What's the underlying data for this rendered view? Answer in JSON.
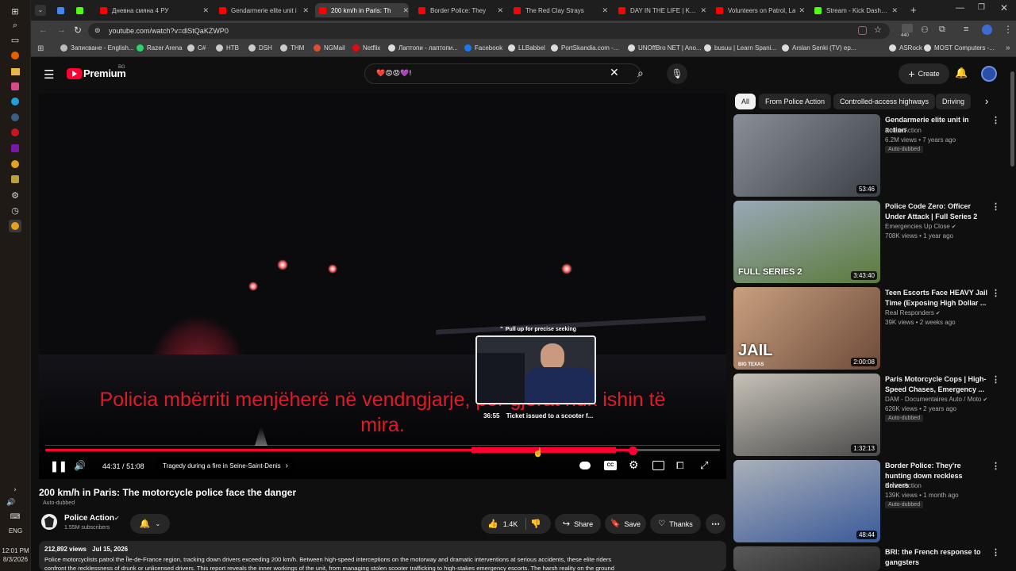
{
  "taskbar": {
    "time": "12:01 PM",
    "date": "8/3/2026",
    "lang": "ENG"
  },
  "tabs": [
    {
      "title": "",
      "active": false,
      "color": "#4285f4"
    },
    {
      "title": "",
      "active": false,
      "color": "#53fc18"
    },
    {
      "title": "Дневна смяна 4 РУ",
      "active": false,
      "color": "#ff0000"
    },
    {
      "title": "Gendarmerie elite unit i",
      "active": false,
      "color": "#ff0000"
    },
    {
      "title": "200 km/h in Paris: Th",
      "active": true,
      "color": "#ff0000"
    },
    {
      "title": "Border Police: They",
      "active": false,
      "color": "#ff0000"
    },
    {
      "title": "The Red Clay Strays",
      "active": false,
      "color": "#ff0000"
    },
    {
      "title": "DAY IN THE LIFE | K-9 D",
      "active": false,
      "color": "#ff0000"
    },
    {
      "title": "Volunteers on Patrol, La",
      "active": false,
      "color": "#ff0000"
    },
    {
      "title": "Stream - Kick Dashboard",
      "active": false,
      "color": "#53fc18"
    }
  ],
  "address": {
    "url": "youtube.com/watch?v=dlStQaKZWP0",
    "extension_count": "440"
  },
  "bookmarks": [
    "Записване - English...",
    "Razer Arena",
    "C#",
    "HTB",
    "DSH",
    "THM",
    "NGMail",
    "Netflix",
    "Лаптопи - лаптопи...",
    "Facebook",
    "LLBabbel",
    "PortSkandia.com -...",
    "UNOffBro NET | Ano...",
    "busuu | Learn Spani...",
    "Arslan Senki (TV) ep...",
    "ASRock",
    "MOST Computers -..."
  ],
  "header": {
    "logo_text": "Premium",
    "logo_badge": "BG",
    "search_value": "❤️😡😡💜!",
    "create_label": "Create"
  },
  "chips": [
    "All",
    "From Police Action",
    "Controlled-access highways",
    "Driving"
  ],
  "player": {
    "caption_line1": "Policia mbërriti menjëherë në vendngjarje, por gjërat nuk ishin të",
    "caption_line2": "mira.",
    "pull_hint": "⌃ Pull up for precise seeking",
    "preview_time": "36:55",
    "preview_chapter": "Ticket issued to a scooter f...",
    "time_current": "44:31",
    "time_total": "51:08",
    "time_sep": "/",
    "chapter": "Tragedy during a fire in Seine-Saint-Denis",
    "progress_fraction": 0.87
  },
  "video": {
    "title": "200 km/h in Paris: The motorcycle police face the danger",
    "auto_dubbed": "Auto-dubbed",
    "channel": "Police Action",
    "subscribers": "1.55M subscribers",
    "likes": "1.4K",
    "share_label": "Share",
    "save_label": "Save",
    "thanks_label": "Thanks",
    "views": "212,892 views",
    "date": "Jul 15, 2026",
    "description_line1": "Police motorcyclists patrol the Île-de-France region, tracking down drivers exceeding 200 km/h. Between high-speed interceptions on the motorway and dramatic interventions at serious accidents, these elite riders",
    "description_line2": "confront the recklessness of drunk or unlicensed drivers. This report reveals the inner workings of the unit, from managing stolen scooter trafficking to high-stakes emergency escorts. The harsh reality on the ground"
  },
  "recommendations": [
    {
      "title": "Gendarmerie elite unit in action",
      "channel": "Police Action",
      "verified": false,
      "meta": "6.2M views • 7 years ago",
      "badge": "Auto-dubbed",
      "duration": "53:46"
    },
    {
      "title": "Police Code Zero: Officer Under Attack | Full Series 2",
      "channel": "Emergencies Up Close",
      "verified": true,
      "meta": "708K views • 1 year ago",
      "badge": "",
      "duration": "3:43:40",
      "overlay": "FULL SERIES 2"
    },
    {
      "title": "Teen Escorts Face HEAVY Jail Time (Exposing High Dollar ...",
      "channel": "Real Responders",
      "verified": true,
      "meta": "39K views • 2 weeks ago",
      "badge": "",
      "duration": "2:00:08",
      "overlay": "JAIL",
      "overlay_sub": "BIG TEXAS"
    },
    {
      "title": "Paris Motorcycle Cops | High-Speed Chases, Emergency ...",
      "channel": "DAM - Documentaires Auto / Moto",
      "verified": true,
      "meta": "626K views • 2 years ago",
      "badge": "Auto-dubbed",
      "duration": "1:32:13"
    },
    {
      "title": "Border Police: They're hunting down reckless drivers",
      "channel": "Police Action",
      "verified": false,
      "meta": "139K views • 1 month ago",
      "badge": "Auto-dubbed",
      "duration": "48:44"
    },
    {
      "title": "BRI: the French response to gangsters",
      "channel": "",
      "verified": false,
      "meta": "",
      "badge": "",
      "duration": ""
    }
  ],
  "colors": {
    "accent": "#ff0033",
    "caption": "#e11a2a",
    "background": "#0f0f0f"
  }
}
